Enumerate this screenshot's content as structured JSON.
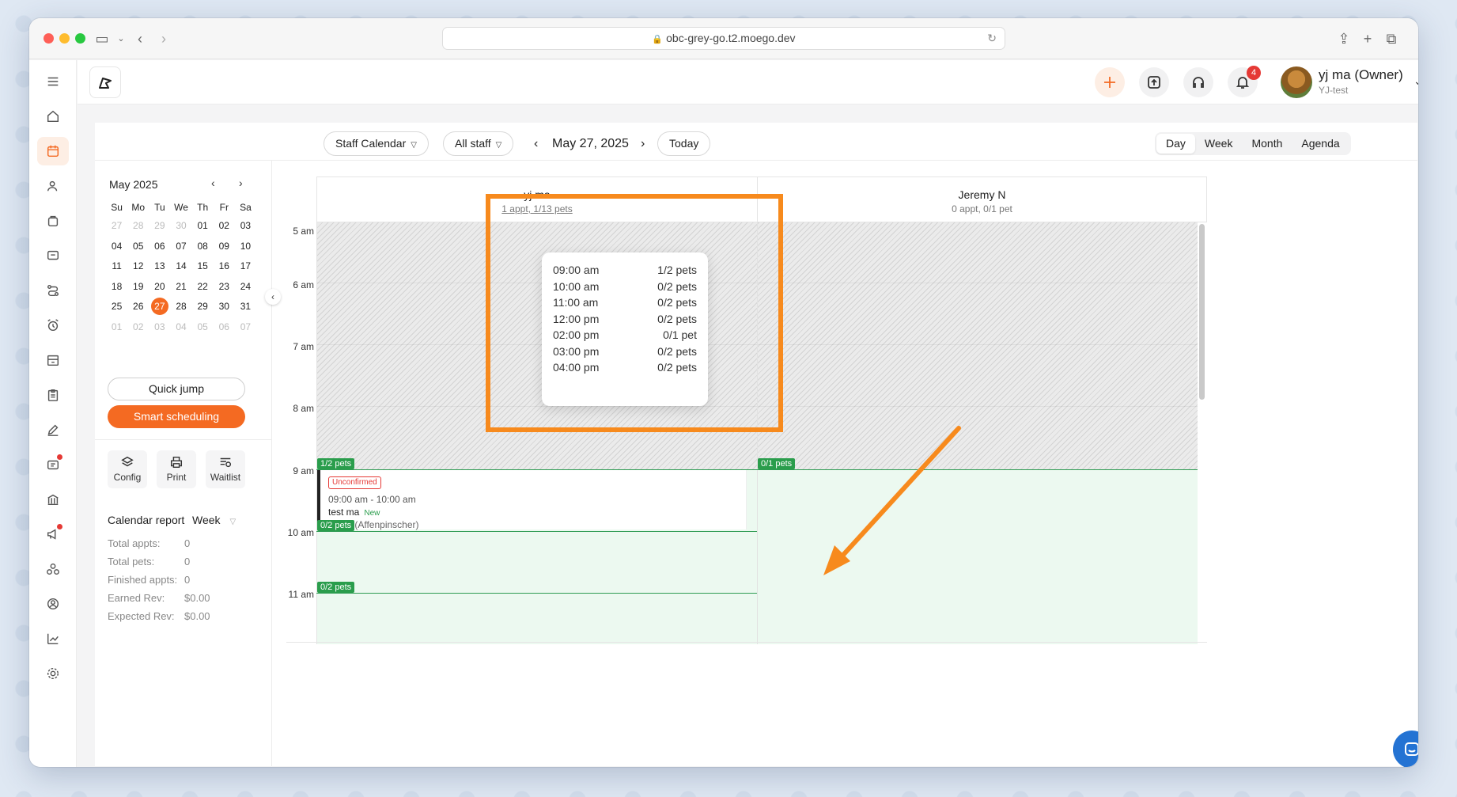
{
  "browser": {
    "url": "obc-grey-go.t2.moego.dev"
  },
  "user": {
    "name": "yj ma (Owner)",
    "business": "YJ-test",
    "notifications": "4"
  },
  "toolbar": {
    "calendar_type": "Staff Calendar",
    "staff_filter": "All staff",
    "date": "May 27, 2025",
    "today": "Today",
    "views": [
      "Day",
      "Week",
      "Month",
      "Agenda"
    ],
    "active_view": "Day"
  },
  "mini_calendar": {
    "title": "May 2025",
    "weekdays": [
      "Su",
      "Mo",
      "Tu",
      "We",
      "Th",
      "Fr",
      "Sa"
    ],
    "days": [
      "27",
      "28",
      "29",
      "30",
      "01",
      "02",
      "03",
      "04",
      "05",
      "06",
      "07",
      "08",
      "09",
      "10",
      "11",
      "12",
      "13",
      "14",
      "15",
      "16",
      "17",
      "18",
      "19",
      "20",
      "21",
      "22",
      "23",
      "24",
      "25",
      "26",
      "27",
      "28",
      "29",
      "30",
      "31",
      "01",
      "02",
      "03",
      "04",
      "05",
      "06",
      "07"
    ],
    "selected": "27"
  },
  "side": {
    "quick_jump": "Quick jump",
    "smart_scheduling": "Smart scheduling",
    "tools": [
      "Config",
      "Print",
      "Waitlist"
    ],
    "report_title": "Calendar report",
    "report_period": "Week",
    "report": [
      {
        "label": "Total appts:",
        "value": "0"
      },
      {
        "label": "Total pets:",
        "value": "0"
      },
      {
        "label": "Finished appts:",
        "value": "0"
      },
      {
        "label": "Earned Rev:",
        "value": "$0.00"
      },
      {
        "label": "Expected Rev:",
        "value": "$0.00"
      }
    ]
  },
  "staff": [
    {
      "name": "yj ma",
      "summary": "1 appt, 1/13 pets"
    },
    {
      "name": "Jeremy N",
      "summary": "0 appt, 0/1 pet"
    }
  ],
  "times": [
    "5 am",
    "6 am",
    "7 am",
    "8 am",
    "9 am",
    "10 am",
    "11 am"
  ],
  "capacity_tags": {
    "yj_9am": "1/2 pets",
    "yj_10am": "0/2 pets",
    "yj_11am": "0/2 pets",
    "jeremy_9am": "0/1 pets"
  },
  "appointment": {
    "status": "Unconfirmed",
    "time": "09:00 am - 10:00 am",
    "client": "test ma",
    "client_tag": "New",
    "pet": "demo (Affenpinscher)"
  },
  "popover": [
    {
      "time": "09:00 am",
      "pets": "1/2 pets"
    },
    {
      "time": "10:00 am",
      "pets": "0/2 pets"
    },
    {
      "time": "11:00 am",
      "pets": "0/2 pets"
    },
    {
      "time": "12:00 pm",
      "pets": "0/2 pets"
    },
    {
      "time": "02:00 pm",
      "pets": "0/1 pet"
    },
    {
      "time": "03:00 pm",
      "pets": "0/2 pets"
    },
    {
      "time": "04:00 pm",
      "pets": "0/2 pets"
    }
  ],
  "colors": {
    "accent": "#f46a22",
    "available": "#2a9d4c",
    "highlight": "#f78a1d"
  }
}
